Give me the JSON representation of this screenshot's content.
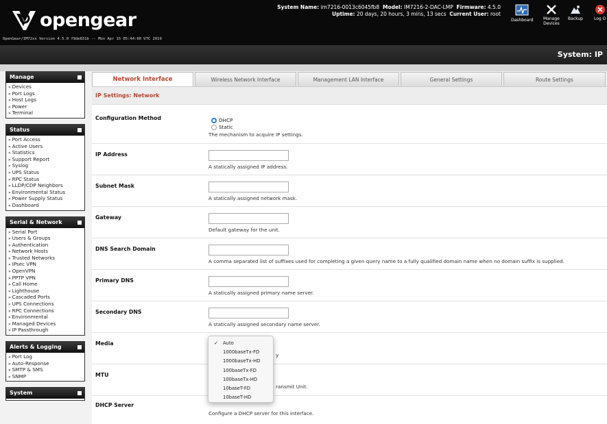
{
  "header": {
    "logo_text": "opengear",
    "version": "OpenGear/IM72xx Version 4.5.0 f9de831b -- Mon Apr 15 05:44:00 UTC 2019",
    "system_name_label": "System Name:",
    "system_name": "im7216-0013c6045fb8",
    "model_label": "Model:",
    "model": "IM7216-2-DAC-LMP",
    "firmware_label": "Firmware:",
    "firmware": "4.5.0",
    "uptime_label": "Uptime:",
    "uptime": "20 days, 20 hours, 3 mins, 13 secs",
    "user_label": "Current User:",
    "user": "root",
    "buttons": {
      "dashboard": "Dashboard",
      "manage_devices_1": "Manage",
      "manage_devices_2": "Devices",
      "backup": "Backup",
      "logout": "Log O"
    }
  },
  "page_title": "System: IP",
  "sidebar": [
    {
      "title": "Manage",
      "items": [
        "Devices",
        "Port Logs",
        "Host Logs",
        "Power",
        "Terminal"
      ]
    },
    {
      "title": "Status",
      "items": [
        "Port Access",
        "Active Users",
        "Statistics",
        "Support Report",
        "Syslog",
        "UPS Status",
        "RPC Status",
        "LLDP/CDP Neighbors",
        "Environmental Status",
        "Power Supply Status",
        "Dashboard"
      ]
    },
    {
      "title": "Serial & Network",
      "items": [
        "Serial Port",
        "Users & Groups",
        "Authentication",
        "Network Hosts",
        "Trusted Networks",
        "IPsec VPN",
        "OpenVPN",
        "PPTP VPN",
        "Call Home",
        "Lighthouse",
        "Cascaded Ports",
        "UPS Connections",
        "RPC Connections",
        "Environmental",
        "Managed Devices",
        "IP Passthrough"
      ]
    },
    {
      "title": "Alerts & Logging",
      "items": [
        "Port Log",
        "Auto-Response",
        "SMTP & SMS",
        "SNMP"
      ]
    },
    {
      "title": "System",
      "items": []
    }
  ],
  "tabs": [
    {
      "label": "Network Interface"
    },
    {
      "label": "Wireless Network Interface"
    },
    {
      "label": "Management LAN Interface"
    },
    {
      "label": "General Settings"
    },
    {
      "label": "Route Settings"
    }
  ],
  "section_title": "IP Settings: Network",
  "form": {
    "config_method": {
      "label": "Configuration Method",
      "option_dhcp": "DHCP",
      "option_static": "Static",
      "desc": "The mechanism to acquire IP settings."
    },
    "ip_address": {
      "label": "IP Address",
      "value": "",
      "desc": "A statically assigned IP address."
    },
    "subnet_mask": {
      "label": "Subnet Mask",
      "value": "",
      "desc": "A statically assigned network mask."
    },
    "gateway": {
      "label": "Gateway",
      "value": "",
      "desc": "Default gateway for the unit."
    },
    "dns_search": {
      "label": "DNS Search Domain",
      "value": "",
      "desc": "A comma separated list of suffixes used for completing a given query name to a fully qualified domain name when no domain suffix is supplied."
    },
    "primary_dns": {
      "label": "Primary DNS",
      "value": "",
      "desc": "A statically assigned primary name server."
    },
    "secondary_dns": {
      "label": "Secondary DNS",
      "value": "",
      "desc": "A statically assigned secondary name server."
    },
    "media": {
      "label": "Media",
      "desc_tail": "y"
    },
    "mtu": {
      "label": "MTU",
      "desc_tail": "ransmit Unit."
    },
    "dhcp_server": {
      "label": "DHCP Server",
      "desc": "Configure a DHCP server for this interface."
    }
  },
  "media_dropdown": {
    "selected": "Auto",
    "options": [
      "Auto",
      "1000baseTx-FD",
      "1000baseTx-HD",
      "100baseTx-FD",
      "100baseTx-HD",
      "10baseT-FD",
      "10baseT-HD"
    ]
  },
  "colors": {
    "accent": "#b5442c",
    "radio_selected": "#2f7bd8",
    "header_bg": "#0a0a0a"
  }
}
